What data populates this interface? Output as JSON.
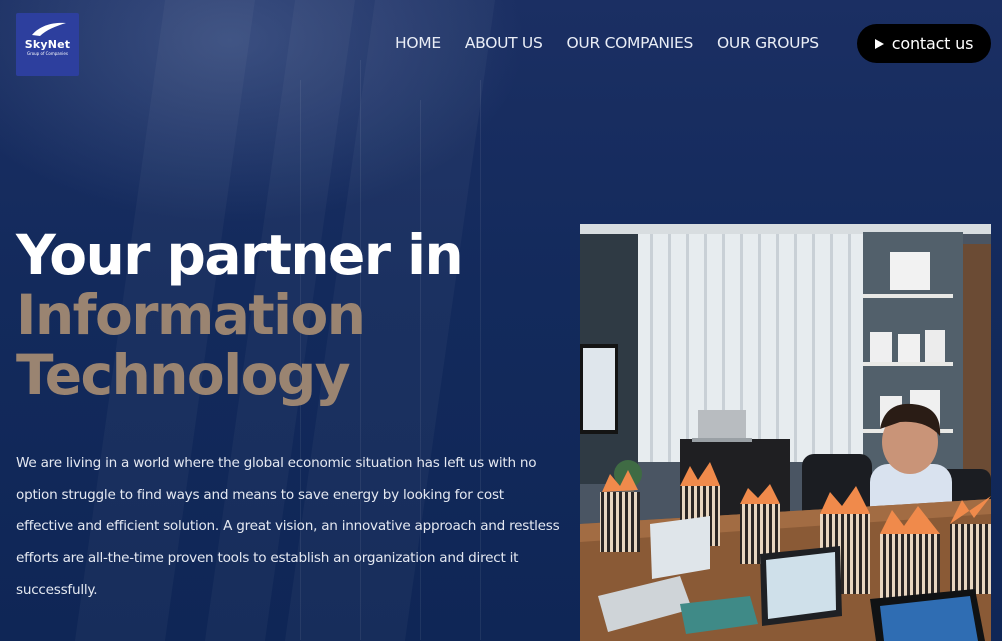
{
  "brand": {
    "name": "SkyNet",
    "tagline": "Group of Companies",
    "logo_bg": "#2d3f9e"
  },
  "nav": {
    "items": [
      {
        "label": "HOME"
      },
      {
        "label": "ABOUT US"
      },
      {
        "label": "OUR COMPANIES"
      },
      {
        "label": "OUR GROUPS"
      }
    ],
    "cta": {
      "label": "contact us",
      "icon": "play-icon"
    }
  },
  "hero": {
    "title_line1": "Your partner in",
    "title_line2": "Information",
    "title_line3": "Technology",
    "accent_color": "#9a8471",
    "body": "We are living in a world where the global economic situation has left us with no option struggle to find ways and means to save energy by looking for cost effective and efficient solution. A great vision, an innovative approach and restless efforts are all-the-time proven tools to establish an organization and direct it successfully."
  },
  "colors": {
    "background": "#10285a",
    "button": "#000000"
  }
}
